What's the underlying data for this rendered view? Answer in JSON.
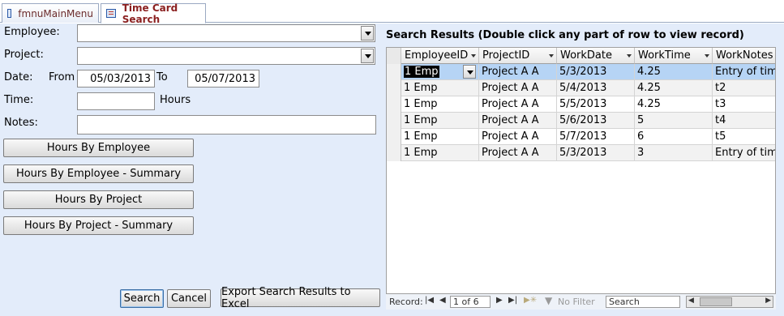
{
  "tabs": [
    {
      "label": "fmnuMainMenu"
    },
    {
      "label": "Time Card Search"
    }
  ],
  "form": {
    "employee_label": "Employee:",
    "employee_value": "",
    "project_label": "Project:",
    "project_value": "",
    "date_label": "Date:",
    "from_label": "From",
    "from_value": "05/03/2013",
    "to_label": "To",
    "to_value": "05/07/2013",
    "time_label": "Time:",
    "time_value": "",
    "hours_label": "Hours",
    "notes_label": "Notes:",
    "notes_value": ""
  },
  "report_buttons": {
    "hours_by_employee": "Hours By Employee",
    "hours_by_employee_summary": "Hours By Employee - Summary",
    "hours_by_project": "Hours By Project",
    "hours_by_project_summary": "Hours By Project - Summary"
  },
  "actions": {
    "search": "Search",
    "cancel": "Cancel",
    "export": "Export Search Results to Excel"
  },
  "results": {
    "title": "Search Results (Double click any part of row to view record)",
    "columns": [
      "EmployeeID",
      "ProjectID",
      "WorkDate",
      "WorkTime",
      "WorkNotes"
    ],
    "rows": [
      [
        "1 Emp",
        "Project A A",
        "5/3/2013",
        "4.25",
        "Entry of time"
      ],
      [
        "1 Emp",
        "Project A A",
        "5/4/2013",
        "4.25",
        "t2"
      ],
      [
        "1 Emp",
        "Project A A",
        "5/5/2013",
        "4.25",
        "t3"
      ],
      [
        "1 Emp",
        "Project A A",
        "5/6/2013",
        "5",
        "t4"
      ],
      [
        "1 Emp",
        "Project A A",
        "5/7/2013",
        "6",
        "t5"
      ],
      [
        "1 Emp",
        "Project A A",
        "5/3/2013",
        "3",
        "Entry of time"
      ]
    ]
  },
  "navigation": {
    "record_label": "Record:",
    "position": "1 of 6",
    "filter_label": "No Filter",
    "search_placeholder": "Search"
  }
}
